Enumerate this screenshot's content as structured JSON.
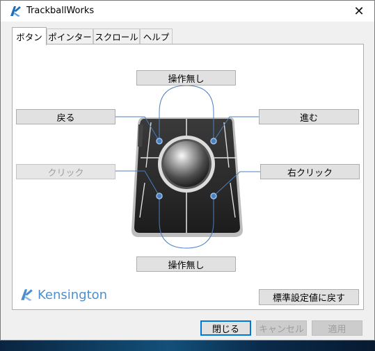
{
  "window": {
    "title": "TrackballWorks"
  },
  "tabs": [
    {
      "label": "ボタン",
      "active": true
    },
    {
      "label": "ポインター",
      "active": false
    },
    {
      "label": "スクロール",
      "active": false
    },
    {
      "label": "ヘルプ",
      "active": false
    }
  ],
  "buttons": {
    "top": "操作無し",
    "upper_left": "戻る",
    "upper_right": "進む",
    "lower_left": "クリック",
    "lower_right": "右クリック",
    "bottom": "操作無し"
  },
  "logo_text": "Kensington",
  "reset_label": "標準設定値に戻す",
  "footer": {
    "close": "閉じる",
    "cancel": "キャンセル",
    "apply": "適用"
  },
  "colors": {
    "accent": "#0078d7",
    "logo": "#4d8fcc",
    "connector": "#4a7fc0"
  }
}
